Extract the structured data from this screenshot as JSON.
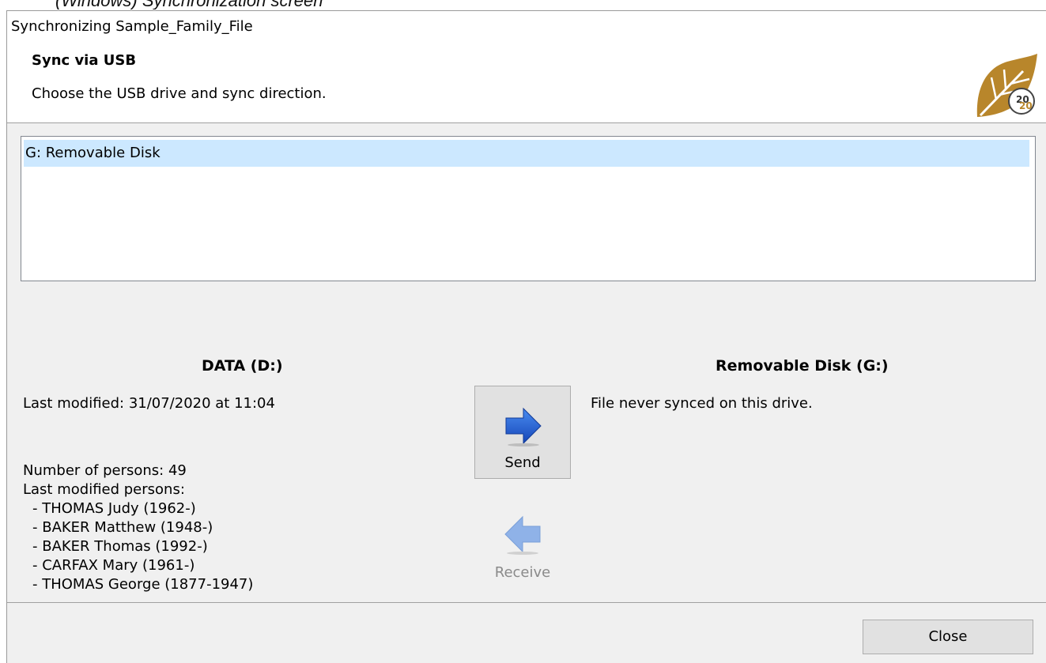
{
  "caption": "(Windows) Synchronization screen",
  "window": {
    "title": "Synchronizing Sample_Family_File"
  },
  "header": {
    "heading": "Sync via USB",
    "subheading": "Choose the USB drive and sync direction.",
    "logo_icon": "leaf-2020-logo",
    "logo_text_top": "20",
    "logo_text_bottom": "20"
  },
  "drives": [
    {
      "label": "G: Removable Disk",
      "selected": true
    }
  ],
  "source": {
    "title": "DATA (D:)",
    "last_modified": "Last modified: 31/07/2020 at 11:04",
    "number_of_persons": "Number of persons: 49",
    "last_modified_persons_label": "Last modified persons:",
    "persons": [
      "- THOMAS Judy (1962-)",
      "- BAKER Matthew (1948-)",
      "- BAKER Thomas (1992-)",
      "- CARFAX Mary (1961-)",
      "- THOMAS George (1877-1947)"
    ]
  },
  "target": {
    "title": "Removable Disk (G:)",
    "status": "File never synced on this drive."
  },
  "actions": {
    "send_label": "Send",
    "send_icon": "arrow-right-icon",
    "receive_label": "Receive",
    "receive_icon": "arrow-left-icon",
    "receive_enabled": false,
    "close_label": "Close"
  },
  "colors": {
    "selection": "#cce8ff",
    "send_arrow": "#1e63d6",
    "receive_arrow_disabled": "#8fb2e8",
    "logo_gold": "#b8862b"
  }
}
